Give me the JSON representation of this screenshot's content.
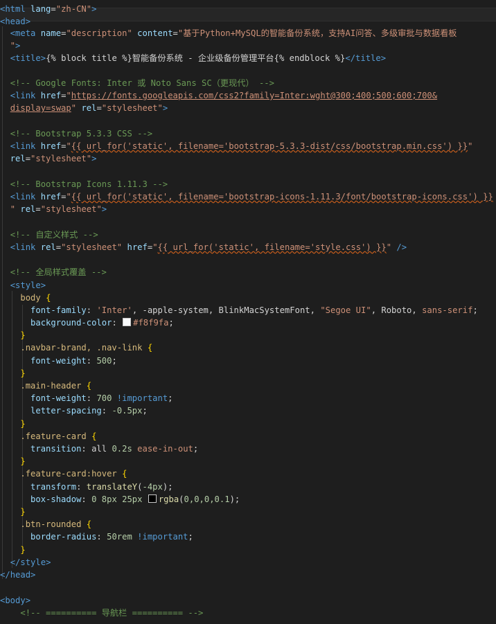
{
  "colors": {
    "background": "#1e1e1e",
    "tag": "#569cd6",
    "attribute": "#9cdcfe",
    "string": "#ce9178",
    "comment": "#6a9955",
    "selector": "#d7ba7d",
    "number": "#b5cea8",
    "function": "#dcdcaa",
    "swatch_f8f9fa": "#f8f9fa",
    "swatch_black": "#000000"
  },
  "lines": [
    [
      [
        "punc",
        "<"
      ],
      [
        "tag",
        "html"
      ],
      [
        "text",
        " "
      ],
      [
        "attr",
        "lang"
      ],
      [
        "text",
        "="
      ],
      [
        "str",
        "\"zh-CN\""
      ],
      [
        "punc",
        ">"
      ]
    ],
    [
      [
        "punc",
        "<"
      ],
      [
        "tag",
        "head"
      ],
      [
        "punc",
        ">"
      ]
    ],
    [
      [
        "text",
        "  "
      ],
      [
        "punc",
        "<"
      ],
      [
        "tag",
        "meta"
      ],
      [
        "text",
        " "
      ],
      [
        "attr",
        "name"
      ],
      [
        "text",
        "="
      ],
      [
        "str",
        "\"description\""
      ],
      [
        "text",
        " "
      ],
      [
        "attr",
        "content"
      ],
      [
        "text",
        "="
      ],
      [
        "str",
        "\"基于Python+MySQL的智能备份系统，支持AI问答、多级审批与数据看板"
      ]
    ],
    [
      [
        "text",
        "  "
      ],
      [
        "str",
        "\""
      ],
      [
        "punc",
        ">"
      ]
    ],
    [
      [
        "text",
        "  "
      ],
      [
        "punc",
        "<"
      ],
      [
        "tag",
        "title"
      ],
      [
        "punc",
        ">"
      ],
      [
        "text",
        "{% block title %}智能备份系统 - 企业级备份管理平台{% endblock %}"
      ],
      [
        "punc",
        "</"
      ],
      [
        "tag",
        "title"
      ],
      [
        "punc",
        ">"
      ]
    ],
    [],
    [
      [
        "text",
        "  "
      ],
      [
        "cmt",
        "<!-- Google Fonts: Inter 或 Noto Sans SC（更现代） -->"
      ]
    ],
    [
      [
        "text",
        "  "
      ],
      [
        "punc",
        "<"
      ],
      [
        "tag",
        "link"
      ],
      [
        "text",
        " "
      ],
      [
        "attr",
        "href"
      ],
      [
        "text",
        "="
      ],
      [
        "str",
        "\""
      ],
      [
        "link",
        "https://fonts.googleapis.com/css2?family=Inter:wght@300;400;500;600;700&"
      ]
    ],
    [
      [
        "text",
        "  "
      ],
      [
        "link",
        "display=swap"
      ],
      [
        "str",
        "\""
      ],
      [
        "text",
        " "
      ],
      [
        "attr",
        "rel"
      ],
      [
        "text",
        "="
      ],
      [
        "str",
        "\"stylesheet\""
      ],
      [
        "punc",
        ">"
      ]
    ],
    [],
    [
      [
        "text",
        "  "
      ],
      [
        "cmt",
        "<!-- Bootstrap 5.3.3 CSS -->"
      ]
    ],
    [
      [
        "text",
        "  "
      ],
      [
        "punc",
        "<"
      ],
      [
        "tag",
        "link"
      ],
      [
        "text",
        " "
      ],
      [
        "attr",
        "href"
      ],
      [
        "text",
        "="
      ],
      [
        "str",
        "\""
      ],
      [
        "tpl",
        "{{ url_for('static', filename='bootstrap-5.3.3-dist/css/bootstrap.min.css') }}"
      ],
      [
        "str",
        "\""
      ]
    ],
    [
      [
        "text",
        "  "
      ],
      [
        "attr",
        "rel"
      ],
      [
        "text",
        "="
      ],
      [
        "str",
        "\"stylesheet\""
      ],
      [
        "punc",
        ">"
      ]
    ],
    [],
    [
      [
        "text",
        "  "
      ],
      [
        "cmt",
        "<!-- Bootstrap Icons 1.11.3 -->"
      ]
    ],
    [
      [
        "text",
        "  "
      ],
      [
        "punc",
        "<"
      ],
      [
        "tag",
        "link"
      ],
      [
        "text",
        " "
      ],
      [
        "attr",
        "href"
      ],
      [
        "text",
        "="
      ],
      [
        "str",
        "\""
      ],
      [
        "tpl",
        "{{ url_for('static', filename='bootstrap-icons-1.11.3/font/bootstrap-icons.css') }}"
      ]
    ],
    [
      [
        "text",
        "  "
      ],
      [
        "str",
        "\""
      ],
      [
        "text",
        " "
      ],
      [
        "attr",
        "rel"
      ],
      [
        "text",
        "="
      ],
      [
        "str",
        "\"stylesheet\""
      ],
      [
        "punc",
        ">"
      ]
    ],
    [],
    [
      [
        "text",
        "  "
      ],
      [
        "cmt",
        "<!-- 自定义样式 -->"
      ]
    ],
    [
      [
        "text",
        "  "
      ],
      [
        "punc",
        "<"
      ],
      [
        "tag",
        "link"
      ],
      [
        "text",
        " "
      ],
      [
        "attr",
        "rel"
      ],
      [
        "text",
        "="
      ],
      [
        "str",
        "\"stylesheet\""
      ],
      [
        "text",
        " "
      ],
      [
        "attr",
        "href"
      ],
      [
        "text",
        "="
      ],
      [
        "str",
        "\""
      ],
      [
        "tpl",
        "{{ url_for('static', filename='style.css') }}"
      ],
      [
        "str",
        "\""
      ],
      [
        "text",
        " "
      ],
      [
        "punc",
        "/>"
      ]
    ],
    [],
    [
      [
        "text",
        "  "
      ],
      [
        "cmt",
        "<!-- 全局样式覆盖 -->"
      ]
    ],
    [
      [
        "text",
        "  "
      ],
      [
        "punc",
        "<"
      ],
      [
        "tag",
        "style"
      ],
      [
        "punc",
        ">"
      ]
    ],
    [
      [
        "text",
        "    "
      ],
      [
        "sel",
        "body"
      ],
      [
        "text",
        " "
      ],
      [
        "brace",
        "{"
      ]
    ],
    [
      [
        "text",
        "      "
      ],
      [
        "prop",
        "font-family"
      ],
      [
        "text",
        ": "
      ],
      [
        "str",
        "'Inter'"
      ],
      [
        "text",
        ", -apple-system, BlinkMacSystemFont, "
      ],
      [
        "str",
        "\"Segoe UI\""
      ],
      [
        "text",
        ", Roboto, "
      ],
      [
        "str",
        "sans-serif"
      ],
      [
        "text",
        ";"
      ]
    ],
    [
      [
        "text",
        "      "
      ],
      [
        "prop",
        "background-color"
      ],
      [
        "text",
        ": "
      ],
      [
        "swatch",
        "#f8f9fa"
      ],
      [
        "str",
        "#f8f9fa"
      ],
      [
        "text",
        ";"
      ]
    ],
    [
      [
        "text",
        "    "
      ],
      [
        "brace",
        "}"
      ]
    ],
    [
      [
        "text",
        "    "
      ],
      [
        "sel",
        ".navbar-brand, .nav-link"
      ],
      [
        "text",
        " "
      ],
      [
        "brace",
        "{"
      ]
    ],
    [
      [
        "text",
        "      "
      ],
      [
        "prop",
        "font-weight"
      ],
      [
        "text",
        ": "
      ],
      [
        "num",
        "500"
      ],
      [
        "text",
        ";"
      ]
    ],
    [
      [
        "text",
        "    "
      ],
      [
        "brace",
        "}"
      ]
    ],
    [
      [
        "text",
        "    "
      ],
      [
        "sel",
        ".main-header"
      ],
      [
        "text",
        " "
      ],
      [
        "brace",
        "{"
      ]
    ],
    [
      [
        "text",
        "      "
      ],
      [
        "prop",
        "font-weight"
      ],
      [
        "text",
        ": "
      ],
      [
        "num",
        "700"
      ],
      [
        "text",
        " "
      ],
      [
        "imp",
        "!important"
      ],
      [
        "text",
        ";"
      ]
    ],
    [
      [
        "text",
        "      "
      ],
      [
        "prop",
        "letter-spacing"
      ],
      [
        "text",
        ": "
      ],
      [
        "num",
        "-0.5px"
      ],
      [
        "text",
        ";"
      ]
    ],
    [
      [
        "text",
        "    "
      ],
      [
        "brace",
        "}"
      ]
    ],
    [
      [
        "text",
        "    "
      ],
      [
        "sel",
        ".feature-card"
      ],
      [
        "text",
        " "
      ],
      [
        "brace",
        "{"
      ]
    ],
    [
      [
        "text",
        "      "
      ],
      [
        "prop",
        "transition"
      ],
      [
        "text",
        ": "
      ],
      [
        "text",
        "all "
      ],
      [
        "num",
        "0.2s"
      ],
      [
        "text",
        " "
      ],
      [
        "str",
        "ease-in-out"
      ],
      [
        "text",
        ";"
      ]
    ],
    [
      [
        "text",
        "    "
      ],
      [
        "brace",
        "}"
      ]
    ],
    [
      [
        "text",
        "    "
      ],
      [
        "sel",
        ".feature-card:hover"
      ],
      [
        "text",
        " "
      ],
      [
        "brace",
        "{"
      ]
    ],
    [
      [
        "text",
        "      "
      ],
      [
        "prop",
        "transform"
      ],
      [
        "text",
        ": "
      ],
      [
        "fn",
        "translateY"
      ],
      [
        "text",
        "("
      ],
      [
        "num",
        "-4px"
      ],
      [
        "text",
        ");"
      ]
    ],
    [
      [
        "text",
        "      "
      ],
      [
        "prop",
        "box-shadow"
      ],
      [
        "text",
        ": "
      ],
      [
        "num",
        "0 8px 25px"
      ],
      [
        "text",
        " "
      ],
      [
        "swatch",
        "#000000"
      ],
      [
        "fn",
        "rgba"
      ],
      [
        "text",
        "("
      ],
      [
        "num",
        "0,0,0,0.1"
      ],
      [
        "text",
        ");"
      ]
    ],
    [
      [
        "text",
        "    "
      ],
      [
        "brace",
        "}"
      ]
    ],
    [
      [
        "text",
        "    "
      ],
      [
        "sel",
        ".btn-rounded"
      ],
      [
        "text",
        " "
      ],
      [
        "brace",
        "{"
      ]
    ],
    [
      [
        "text",
        "      "
      ],
      [
        "prop",
        "border-radius"
      ],
      [
        "text",
        ": "
      ],
      [
        "num",
        "50rem"
      ],
      [
        "text",
        " "
      ],
      [
        "imp",
        "!important"
      ],
      [
        "text",
        ";"
      ]
    ],
    [
      [
        "text",
        "    "
      ],
      [
        "brace",
        "}"
      ]
    ],
    [
      [
        "text",
        "  "
      ],
      [
        "punc",
        "</"
      ],
      [
        "tag",
        "style"
      ],
      [
        "punc",
        ">"
      ]
    ],
    [
      [
        "punc",
        "</"
      ],
      [
        "tag",
        "head"
      ],
      [
        "punc",
        ">"
      ]
    ],
    [],
    [
      [
        "punc",
        "<"
      ],
      [
        "tag",
        "body"
      ],
      [
        "punc",
        ">"
      ]
    ],
    [
      [
        "text",
        "    "
      ],
      [
        "cmt",
        "<!-- ========== 导航栏 ========== -->"
      ]
    ]
  ]
}
